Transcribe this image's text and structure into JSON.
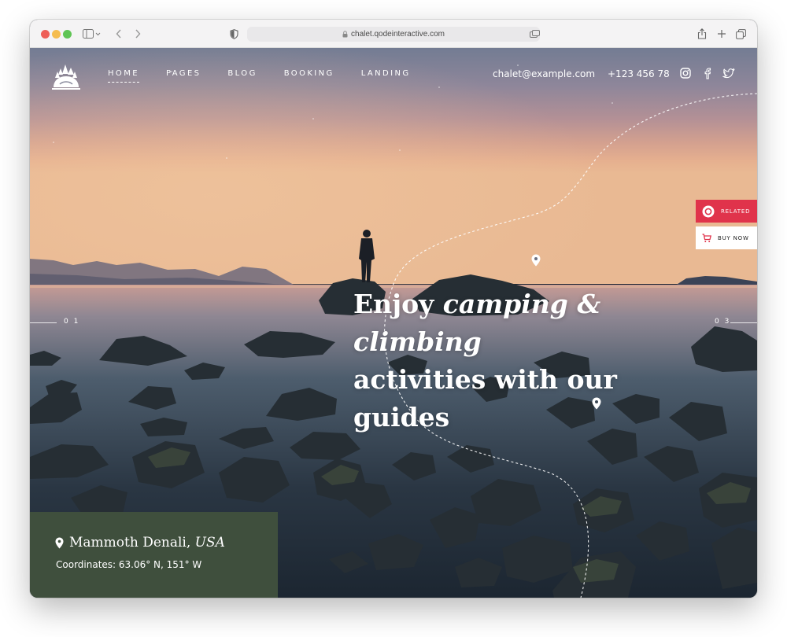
{
  "browser": {
    "url": "chalet.qodeinteractive.com"
  },
  "nav": {
    "items": [
      "HOME",
      "PAGES",
      "BLOG",
      "BOOKING",
      "LANDING"
    ],
    "active_index": 0
  },
  "contact": {
    "email": "chalet@example.com",
    "phone": "+123 456 78"
  },
  "social": [
    "instagram-icon",
    "facebook-icon",
    "twitter-icon"
  ],
  "hero": {
    "headline_plain_1": "Enjoy ",
    "headline_italic": "camping & climbing",
    "headline_line_2": "activities with our guides",
    "slide_prev": "0 1",
    "slide_next": "0 3"
  },
  "side_buttons": {
    "related": "RELATED",
    "buy_now": "BUY NOW"
  },
  "location": {
    "name": "Mammoth Denali, ",
    "country": "USA",
    "coordinates": "Coordinates: 63.06° N, 151° W"
  },
  "colors": {
    "accent_red": "#e0334b",
    "location_green": "#3f4f3d"
  }
}
